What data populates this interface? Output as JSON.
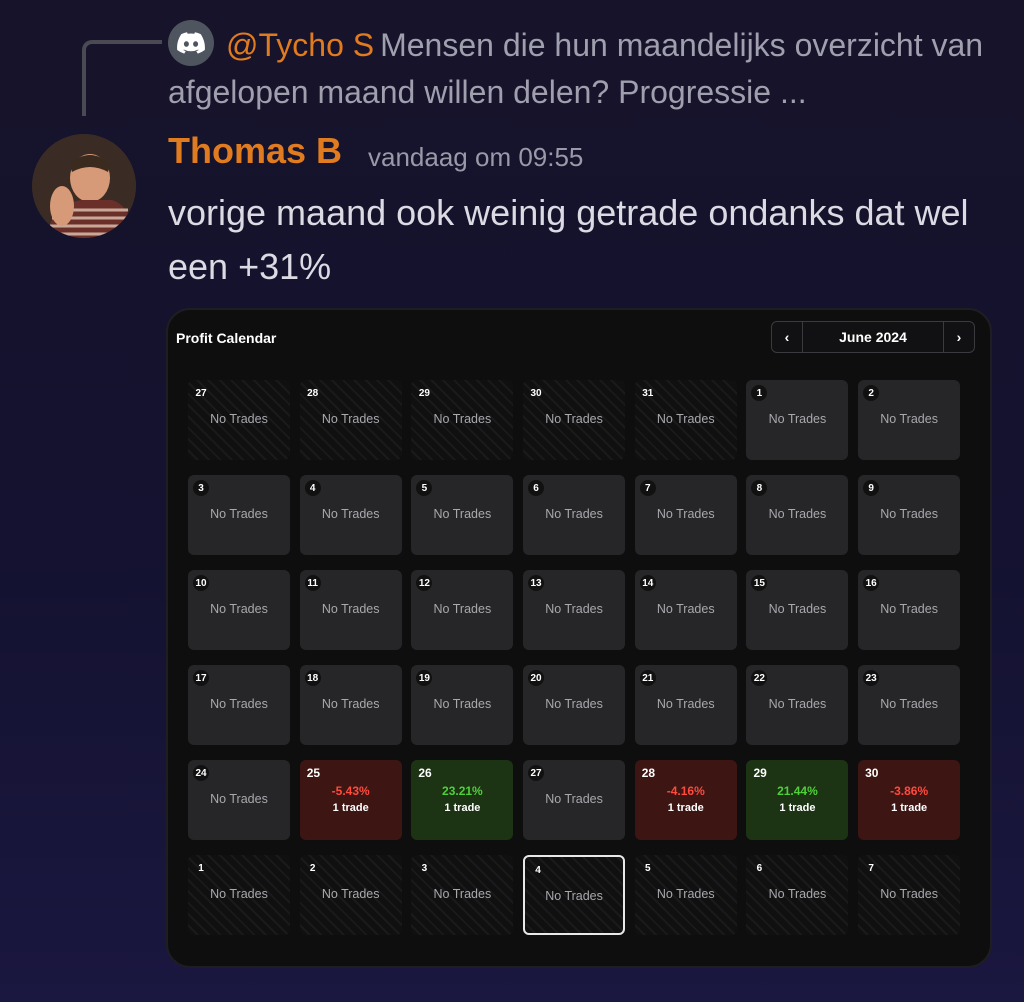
{
  "reply": {
    "author": "@Tycho S",
    "text": "Mensen die hun maandelijks overzicht van afgelopen maand willen delen? Progressie ..."
  },
  "message": {
    "author": "Thomas B",
    "timestamp": "vandaag om 09:55",
    "text": "vorige maand ook weinig getrade ondanks dat wel een +31%"
  },
  "calendar": {
    "title": "Profit Calendar",
    "month": "June 2024",
    "prev_icon": "‹",
    "next_icon": "›",
    "no_trades_label": "No Trades",
    "colors": {
      "loss": "#ff4a3d",
      "profit": "#4fd03a",
      "loss_bg": "#3d1614",
      "profit_bg": "#1c3314"
    },
    "days": [
      {
        "day": "27",
        "type": "outside"
      },
      {
        "day": "28",
        "type": "outside"
      },
      {
        "day": "29",
        "type": "outside"
      },
      {
        "day": "30",
        "type": "outside"
      },
      {
        "day": "31",
        "type": "outside"
      },
      {
        "day": "1",
        "type": "empty"
      },
      {
        "day": "2",
        "type": "empty"
      },
      {
        "day": "3",
        "type": "empty"
      },
      {
        "day": "4",
        "type": "empty"
      },
      {
        "day": "5",
        "type": "empty"
      },
      {
        "day": "6",
        "type": "empty"
      },
      {
        "day": "7",
        "type": "empty"
      },
      {
        "day": "8",
        "type": "empty"
      },
      {
        "day": "9",
        "type": "empty"
      },
      {
        "day": "10",
        "type": "empty"
      },
      {
        "day": "11",
        "type": "empty"
      },
      {
        "day": "12",
        "type": "empty"
      },
      {
        "day": "13",
        "type": "empty"
      },
      {
        "day": "14",
        "type": "empty"
      },
      {
        "day": "15",
        "type": "empty"
      },
      {
        "day": "16",
        "type": "empty"
      },
      {
        "day": "17",
        "type": "empty"
      },
      {
        "day": "18",
        "type": "empty"
      },
      {
        "day": "19",
        "type": "empty"
      },
      {
        "day": "20",
        "type": "empty"
      },
      {
        "day": "21",
        "type": "empty"
      },
      {
        "day": "22",
        "type": "empty"
      },
      {
        "day": "23",
        "type": "empty"
      },
      {
        "day": "24",
        "type": "empty"
      },
      {
        "day": "25",
        "type": "loss",
        "pct": "-5.43%",
        "trades": "1 trade"
      },
      {
        "day": "26",
        "type": "profit",
        "pct": "23.21%",
        "trades": "1 trade"
      },
      {
        "day": "27",
        "type": "empty"
      },
      {
        "day": "28",
        "type": "loss",
        "pct": "-4.16%",
        "trades": "1 trade"
      },
      {
        "day": "29",
        "type": "profit",
        "pct": "21.44%",
        "trades": "1 trade"
      },
      {
        "day": "30",
        "type": "loss",
        "pct": "-3.86%",
        "trades": "1 trade"
      },
      {
        "day": "1",
        "type": "outside"
      },
      {
        "day": "2",
        "type": "outside"
      },
      {
        "day": "3",
        "type": "outside"
      },
      {
        "day": "4",
        "type": "outside",
        "today": true
      },
      {
        "day": "5",
        "type": "outside"
      },
      {
        "day": "6",
        "type": "outside"
      },
      {
        "day": "7",
        "type": "outside"
      }
    ]
  }
}
